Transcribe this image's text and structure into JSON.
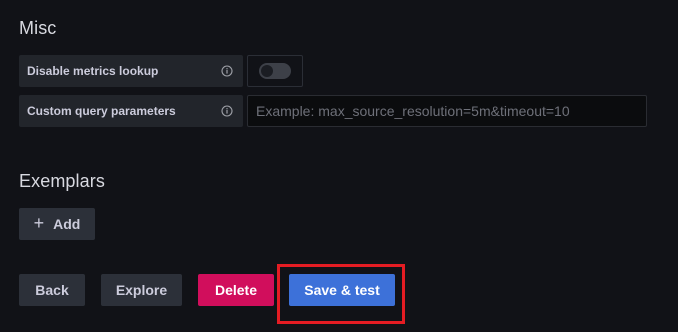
{
  "misc": {
    "title": "Misc",
    "disable_metrics_lookup": {
      "label": "Disable metrics lookup",
      "enabled": false
    },
    "custom_query_parameters": {
      "label": "Custom query parameters",
      "value": "",
      "placeholder": "Example: max_source_resolution=5m&timeout=10"
    }
  },
  "exemplars": {
    "title": "Exemplars",
    "add_label": "Add",
    "add_icon": "plus-icon"
  },
  "actions": {
    "back_label": "Back",
    "explore_label": "Explore",
    "delete_label": "Delete",
    "save_test_label": "Save & test"
  },
  "colors": {
    "background": "#111217",
    "label_bg": "#22252b",
    "secondary_button": "#2c3039",
    "danger_button": "#d10e5c",
    "primary_button": "#3d71d9",
    "highlight_outline": "#e51c23"
  }
}
